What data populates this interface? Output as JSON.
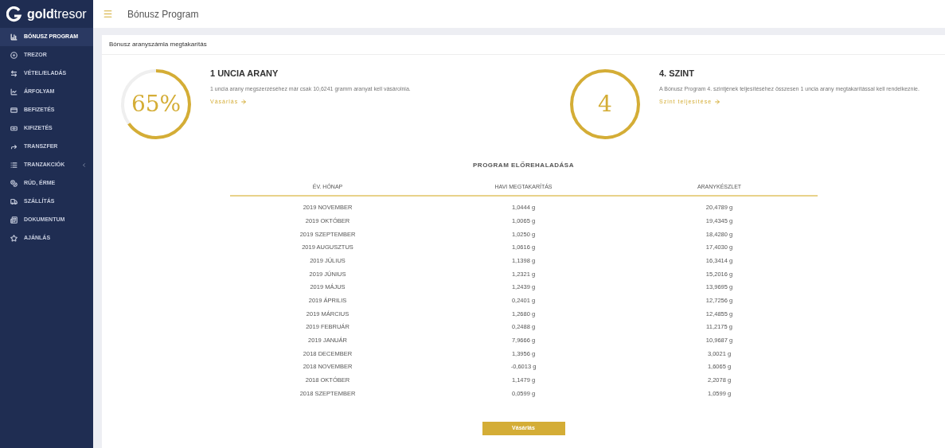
{
  "logo": {
    "bold": "gold",
    "light": "tresor"
  },
  "sidebar": {
    "items": [
      {
        "label": "BÓNUSZ PROGRAM",
        "selected": true,
        "has_submenu": false
      },
      {
        "label": "TREZOR",
        "selected": false,
        "has_submenu": false
      },
      {
        "label": "VÉTEL/ELADÁS",
        "selected": false,
        "has_submenu": false
      },
      {
        "label": "ÁRFOLYAM",
        "selected": false,
        "has_submenu": false
      },
      {
        "label": "BEFIZETÉS",
        "selected": false,
        "has_submenu": false
      },
      {
        "label": "KIFIZETÉS",
        "selected": false,
        "has_submenu": false
      },
      {
        "label": "TRANSZFER",
        "selected": false,
        "has_submenu": false
      },
      {
        "label": "TRANZAKCIÓK",
        "selected": false,
        "has_submenu": true
      },
      {
        "label": "RÚD, ÉRME",
        "selected": false,
        "has_submenu": false
      },
      {
        "label": "SZÁLLÍTÁS",
        "selected": false,
        "has_submenu": false
      },
      {
        "label": "DOKUMENTUM",
        "selected": false,
        "has_submenu": false
      },
      {
        "label": "AJÁNLÁS",
        "selected": false,
        "has_submenu": false
      }
    ]
  },
  "header": {
    "title": "Bónusz Program"
  },
  "card": {
    "title": "Bónusz aranyszámla megtakarítás",
    "stats": [
      {
        "kind": "progress",
        "value": "65%",
        "level": 0.65,
        "heading": "1 UNCIA ARANY",
        "text": "1 uncia arany megszerzéséhez már csak 10,6241 gramm aranyat kell vásárolnia.",
        "link": "Vásárlás"
      },
      {
        "kind": "level",
        "value": "4",
        "heading": "4. SZINT",
        "text": "A Bónusz Program 4. szintjének teljesítéséhez összesen 1 uncia arany megtakarítással kell rendelkeznie.",
        "link": "Szint teljesítése"
      }
    ],
    "table": {
      "title": "PROGRAM ELŐREHALADÁSA",
      "columns": [
        "ÉV. HÓNAP",
        "HAVI MEGTAKARÍTÁS",
        "ARANYKÉSZLET"
      ],
      "rows": [
        [
          "2019 NOVEMBER",
          "1,0444 g",
          "20,4789 g"
        ],
        [
          "2019 OKTÓBER",
          "1,0065 g",
          "19,4345 g"
        ],
        [
          "2019 SZEPTEMBER",
          "1,0250 g",
          "18,4280 g"
        ],
        [
          "2019 AUGUSZTUS",
          "1,0616 g",
          "17,4030 g"
        ],
        [
          "2019 JÚLIUS",
          "1,1398 g",
          "16,3414 g"
        ],
        [
          "2019 JÚNIUS",
          "1,2321 g",
          "15,2016 g"
        ],
        [
          "2019 MÁJUS",
          "1,2439 g",
          "13,9695 g"
        ],
        [
          "2019 ÁPRILIS",
          "0,2401 g",
          "12,7256 g"
        ],
        [
          "2019 MÁRCIUS",
          "1,2680 g",
          "12,4855 g"
        ],
        [
          "2019 FEBRUÁR",
          "0,2488 g",
          "11,2175 g"
        ],
        [
          "2019 JANUÁR",
          "7,9666 g",
          "10,9687 g"
        ],
        [
          "2018 DECEMBER",
          "1,3956 g",
          "3,0021 g"
        ],
        [
          "2018 NOVEMBER",
          "-0,6013 g",
          "1,6065 g"
        ],
        [
          "2018 OKTÓBER",
          "1,1479 g",
          "2,2078 g"
        ],
        [
          "2018 SZEPTEMBER",
          "0,0599 g",
          "1,0599 g"
        ]
      ]
    },
    "button": "Vásárlás"
  }
}
